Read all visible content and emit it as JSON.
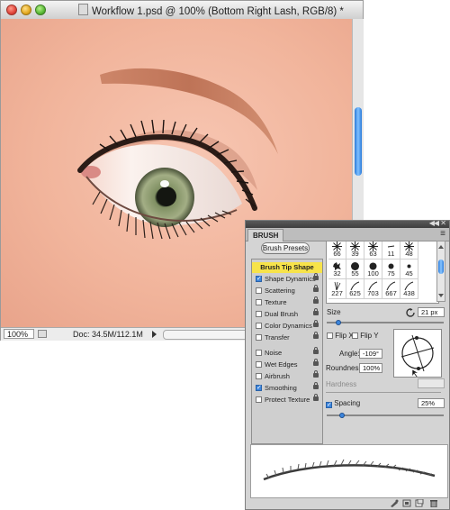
{
  "document": {
    "title": "Workflow 1.psd @ 100% (Bottom Right Lash, RGB/8) *",
    "zoom": "100%",
    "doc_info": "Doc: 34.5M/112.1M"
  },
  "brush_panel": {
    "tab_label": "BRUSH",
    "presets_button": "Brush Presets",
    "options": [
      {
        "label": "Brush Tip Shape",
        "selected": true
      },
      {
        "label": "Shape Dynamics",
        "checked": true,
        "lock": true
      },
      {
        "label": "Scattering",
        "checked": false,
        "lock": true
      },
      {
        "label": "Texture",
        "checked": false,
        "lock": true
      },
      {
        "label": "Dual Brush",
        "checked": false,
        "lock": true
      },
      {
        "label": "Color Dynamics",
        "checked": false,
        "lock": true
      },
      {
        "label": "Transfer",
        "checked": false,
        "lock": true
      },
      {
        "label": "Noise",
        "checked": false,
        "lock": true
      },
      {
        "label": "Wet Edges",
        "checked": false,
        "lock": true
      },
      {
        "label": "Airbrush",
        "checked": false,
        "lock": true
      },
      {
        "label": "Smoothing",
        "checked": true,
        "lock": true
      },
      {
        "label": "Protect Texture",
        "checked": false,
        "lock": true
      }
    ],
    "tips": [
      {
        "size": "66",
        "shape": "star"
      },
      {
        "size": "39",
        "shape": "star"
      },
      {
        "size": "63",
        "shape": "star"
      },
      {
        "size": "11",
        "shape": "dash"
      },
      {
        "size": "48",
        "shape": "star"
      },
      {
        "size": "32",
        "shape": "splat"
      },
      {
        "size": "55",
        "shape": "dot"
      },
      {
        "size": "100",
        "shape": "dot"
      },
      {
        "size": "75",
        "shape": "dot"
      },
      {
        "size": "45",
        "shape": "dot"
      },
      {
        "size": "227",
        "shape": "hair"
      },
      {
        "size": "625",
        "shape": "curve"
      },
      {
        "size": "703",
        "shape": "curve"
      },
      {
        "size": "667",
        "shape": "curve"
      },
      {
        "size": "438",
        "shape": "curve"
      }
    ],
    "size_label": "Size",
    "size_value": "21 px",
    "flip_x_label": "Flip X",
    "flip_y_label": "Flip Y",
    "angle_label": "Angle:",
    "angle_value": "-109°",
    "roundness_label": "Roundness:",
    "roundness_value": "100%",
    "hardness_label": "Hardness",
    "spacing_label": "Spacing",
    "spacing_checked": true,
    "spacing_value": "25%"
  },
  "colors": {
    "accent_blue": "#3d86dd",
    "selected_option": "#f7e34a",
    "skin": "#f2b9a2"
  }
}
